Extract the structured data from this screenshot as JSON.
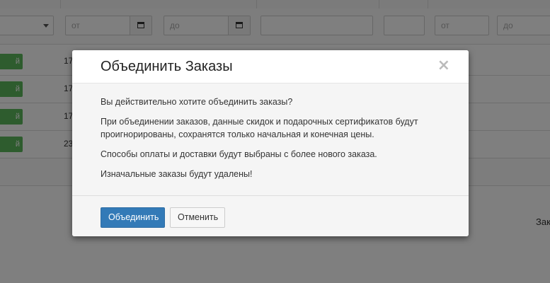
{
  "background": {
    "filters": {
      "from_placeholder_1": "от",
      "to_placeholder_1": "до",
      "from_placeholder_2": "от",
      "to_placeholder_2": "до"
    },
    "rows": [
      {
        "badge": "й",
        "number": "17"
      },
      {
        "badge": "й",
        "number": "17"
      },
      {
        "badge": "й",
        "number": "17"
      },
      {
        "badge": "й",
        "number": "23"
      }
    ],
    "right_text": "Зак",
    "accent_color": "#5cb85c"
  },
  "modal": {
    "title": "Объединить Заказы",
    "close_label": "×",
    "paragraphs": [
      "Вы действительно хотите объединить заказы?",
      "При объединении заказов, данные скидок и подарочных сертификатов будут проигнорированы, сохранятся только начальная и конечная цены.",
      "Способы оплаты и доставки будут выбраны с более нового заказа.",
      "Изначальные заказы будут удалены!"
    ],
    "buttons": {
      "confirm": "Объединить",
      "cancel": "Отменить"
    },
    "primary_color": "#337ab7"
  }
}
